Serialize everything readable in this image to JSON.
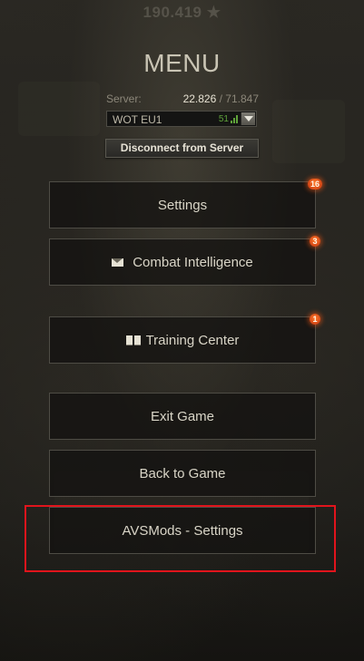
{
  "header": {
    "gold_total": "190.419 ★",
    "title": "MENU"
  },
  "server": {
    "label": "Server:",
    "online": "22.826",
    "separator": " / ",
    "total": "71.847",
    "selected": "WOT EU1",
    "ping": "51",
    "disconnect_label": "Disconnect from Server"
  },
  "menu": {
    "settings": {
      "label": "Settings",
      "badge": "16"
    },
    "combat_intelligence": {
      "label": "Combat Intelligence",
      "badge": "3",
      "icon": "envelope-icon"
    },
    "training_center": {
      "label": "Training Center",
      "badge": "1",
      "icon": "book-icon"
    },
    "exit_game": {
      "label": "Exit Game"
    },
    "back_to_game": {
      "label": "Back to Game"
    },
    "avsmods_settings": {
      "label": "AVSMods - Settings"
    }
  },
  "colors": {
    "highlight": "#e1141c",
    "badge": "#e0521a",
    "ping_good": "#5fa23a"
  }
}
